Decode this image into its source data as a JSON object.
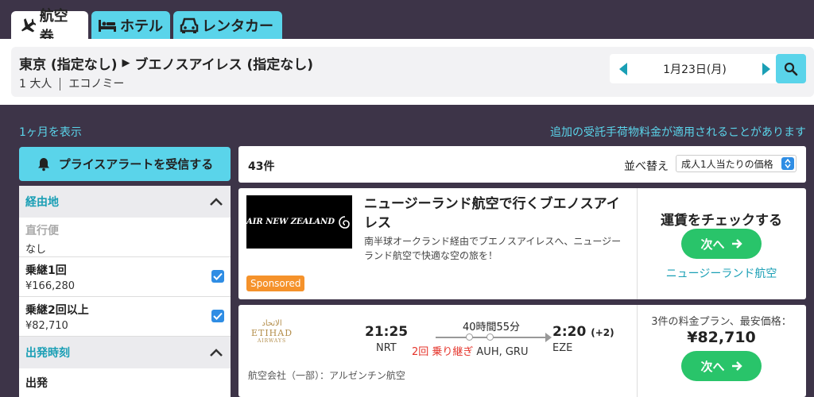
{
  "tabs": [
    {
      "label": "航空券",
      "icon": "airplane-icon",
      "active": true
    },
    {
      "label": "ホテル",
      "icon": "bed-icon",
      "active": false
    },
    {
      "label": "レンタカー",
      "icon": "car-icon",
      "active": false
    }
  ],
  "summary": {
    "route_from": "東京 (指定なし)",
    "route_to": "ブエノスアイレス (指定なし)",
    "passengers": "1 大人",
    "cabin": "エコノミー",
    "date": "1月23日(月)"
  },
  "panel": {
    "month_link": "1ヶ月を表示",
    "fee_note": "追加の受託手荷物料金が適用されることがあります"
  },
  "sidebar": {
    "alert_button": "プライスアラートを受信する",
    "stops_header": "経由地",
    "stops": [
      {
        "label": "直行便",
        "price": "なし",
        "checked": false,
        "disabled": true
      },
      {
        "label": "乗継1回",
        "price": "¥166,280",
        "checked": true,
        "disabled": false
      },
      {
        "label": "乗継2回以上",
        "price": "¥82,710",
        "checked": true,
        "disabled": false
      }
    ],
    "time_header": "出発時刻",
    "departure_label": "出発"
  },
  "results": {
    "count": "43件",
    "sort_label": "並べ替え",
    "sort_value": "成人1人当たりの価格"
  },
  "ad": {
    "logo_text": "AIR NEW ZEALAND",
    "title": "ニュージーランド航空で行くブエノスアイレス",
    "description": "南半球オークランド経由でブエノスアイレスへ、ニュージーランド航空で快適な空の旅を！",
    "sponsored": "Sponsored",
    "check_text": "運賃をチェックする",
    "next_label": "次へ",
    "airline_link": "ニュージーランド航空"
  },
  "flight": {
    "logo_arabic": "الاتحاد",
    "logo_text": "ETIHAD",
    "logo_sub": "AIRWAYS",
    "dep_time": "21:25",
    "dep_code": "NRT",
    "duration": "40時間55分",
    "stops_text": "2回 乗り継ぎ",
    "via": "AUH, GRU",
    "arr_time": "2:20",
    "arr_plus": "(+2)",
    "arr_code": "EZE",
    "operated_by": "航空会社（一部）：アルゼンチン航空",
    "plans_text": "3件の料金プラン、最安価格：",
    "price": "¥82,710",
    "next_label": "次へ"
  },
  "colors": {
    "accent": "#5ad4ea",
    "dark_bg": "#3d3448",
    "cta_green": "#29c46a",
    "link_blue": "#1a9fb5",
    "sponsored_orange": "#f5922b",
    "alert_red": "#e5332a"
  }
}
